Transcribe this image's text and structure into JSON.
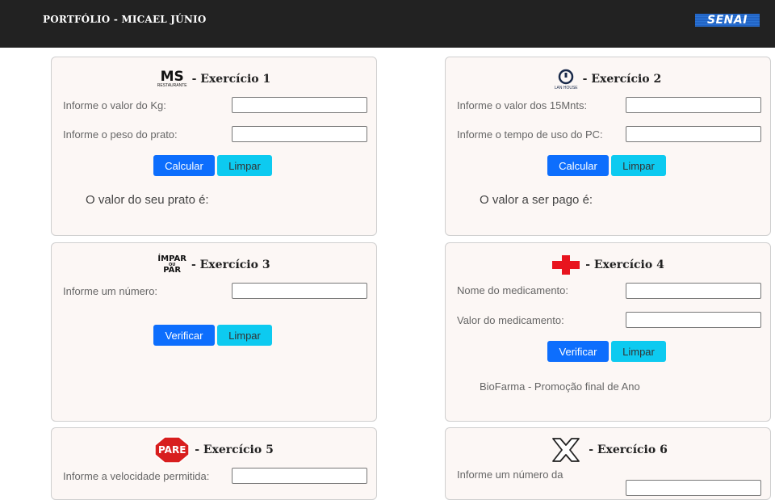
{
  "header": {
    "brand": "PORTFÓLIO - MICAEL JÚNIO",
    "logo_text": "SENAI"
  },
  "cards": {
    "c1": {
      "logo_text": "MS",
      "logo_sub": "RESTAURANTE",
      "title": "- Exercício 1",
      "label1": "Informe o valor do Kg:",
      "label2": "Informe o peso do prato:",
      "btn_primary": "Calcular",
      "btn_clear": "Limpar",
      "result": "O valor do seu prato é:"
    },
    "c2": {
      "logo_sub": "LAN HOUSE",
      "title": "- Exercício 2",
      "label1": "Informe o valor dos 15Mnts:",
      "label2": "Informe o tempo de uso do PC:",
      "btn_primary": "Calcular",
      "btn_clear": "Limpar",
      "result": "O valor a ser pago é:"
    },
    "c3": {
      "logo_top": "ÍMPAR",
      "logo_mid": "OU",
      "logo_bot": "PAR",
      "title": "- Exercício 3",
      "label1": "Informe um número:",
      "btn_primary": "Verificar",
      "btn_clear": "Limpar"
    },
    "c4": {
      "title": "- Exercício 4",
      "label1": "Nome do medicamento:",
      "label2": "Valor do medicamento:",
      "btn_primary": "Verificar",
      "btn_clear": "Limpar",
      "result": "BioFarma - Promoção final de Ano"
    },
    "c5": {
      "logo_text": "PARE",
      "title": "- Exercício 5",
      "label1": "Informe a velocidade permitida:"
    },
    "c6": {
      "title": "- Exercício 6",
      "label1": "Informe um número da"
    }
  },
  "colors": {
    "header_bg": "#222222",
    "card_bg": "#fcf7f5",
    "primary": "#0d6efd",
    "info": "#0dcaf0",
    "cross_red": "#e8141e",
    "stop_red": "#d81e1e"
  }
}
